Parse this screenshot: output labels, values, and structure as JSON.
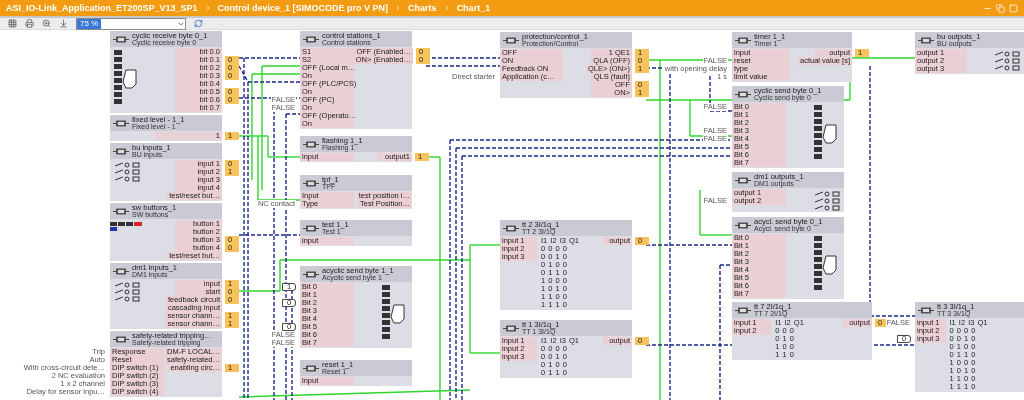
{
  "title_bar": {
    "path": [
      "ASI_IO-Link_Application_ET200SP_V13_SP1",
      "Control device_1 [SIMOCODE pro V PN]",
      "Charts",
      "Chart_1"
    ]
  },
  "toolbar": {
    "zoom": "75 %"
  },
  "blocks": [
    {
      "kind": "byte",
      "title": "cyclic receive byte 0_1",
      "subtitle": "Cyclic receive byte 0",
      "outputs": [
        {
          "name": "bit 0.0"
        },
        {
          "name": "bit 0.1",
          "value": "0"
        },
        {
          "name": "bit 0.2",
          "value": "0"
        },
        {
          "name": "bit 0.3",
          "value": "0"
        },
        {
          "name": "bit 0.4"
        },
        {
          "name": "bit 0.5",
          "value": "0"
        },
        {
          "name": "bit 0.6",
          "value": "0"
        },
        {
          "name": "bit 0.7"
        }
      ]
    },
    {
      "kind": "plain",
      "title": "control stations_1",
      "subtitle": "Control stations",
      "inputs": [
        {
          "name": "S1"
        },
        {
          "name": "S2"
        },
        {
          "name": "OFF (Local m…"
        },
        {
          "name": "On"
        },
        {
          "name": "OFF (PLC/PCS)"
        },
        {
          "name": "On"
        },
        {
          "name": "OFF (PC)",
          "note": "FALSE"
        },
        {
          "name": "On",
          "note": "FALSE"
        },
        {
          "name": "OFF (Operato…"
        },
        {
          "name": "On"
        }
      ],
      "outputs": [
        {
          "name": "OFF (Enabled…",
          "value": "0"
        },
        {
          "name": "ON> (Enabled…",
          "value": "0"
        }
      ]
    },
    {
      "kind": "plain",
      "title": "protection/control_1",
      "subtitle": "Protection/Control",
      "inputs": [
        {
          "name": "OFF"
        },
        {
          "name": "ON"
        },
        {
          "name": "Feedback ON"
        },
        {
          "name": "Application (c…",
          "note": "Direct starter"
        }
      ],
      "outputs": [
        {
          "name": "1 QE1",
          "value": "1"
        },
        {
          "name": "QLA (OFF)",
          "value": "0"
        },
        {
          "name": "QLE> (ON>)",
          "value": "1"
        },
        {
          "name": "QLS (fault)"
        },
        {
          "name": "OFF",
          "value": "0"
        },
        {
          "name": "ON>",
          "value": "1"
        }
      ]
    },
    {
      "kind": "plain",
      "title": "timer 1_1",
      "subtitle": "Timer 1",
      "inputs": [
        {
          "name": "input"
        },
        {
          "name": "reset",
          "note": "FALSE"
        },
        {
          "name": "type",
          "note": "with opening delay"
        },
        {
          "name": "limit value",
          "note": "1 s"
        }
      ],
      "outputs": [
        {
          "name": "output",
          "value": "1"
        },
        {
          "name": "actual value [s]"
        }
      ]
    },
    {
      "kind": "switches",
      "title": "bu outputs_1",
      "subtitle": "BU outputs",
      "inputs": [
        {
          "name": "output 1"
        },
        {
          "name": "output 2"
        },
        {
          "name": "output 3"
        }
      ]
    },
    {
      "kind": "plain",
      "title": "fixed level - 1_1",
      "subtitle": "Fixed level - 1",
      "outputs": [
        {
          "name": "1",
          "value": "1"
        }
      ]
    },
    {
      "kind": "plain",
      "title": "flashing 1_1",
      "subtitle": "Flashing 1",
      "inputs": [
        {
          "name": "input"
        }
      ],
      "outputs": [
        {
          "name": "output1",
          "value": "1"
        }
      ]
    },
    {
      "kind": "byte",
      "title": "cyclic send byte 0_1",
      "subtitle": "Cyclic send byte 0",
      "inputs": [
        {
          "name": "Bit 0",
          "note": "FALSE"
        },
        {
          "name": "Bit 1"
        },
        {
          "name": "Bit 2"
        },
        {
          "name": "Bit 3",
          "note": "FALSE"
        },
        {
          "name": "Bit 4",
          "note": "FALSE"
        },
        {
          "name": "Bit 5"
        },
        {
          "name": "Bit 6"
        },
        {
          "name": "Bit 7"
        }
      ]
    },
    {
      "kind": "switches",
      "title": "bu inputs_1",
      "subtitle": "BU inputs",
      "outputs": [
        {
          "name": "input 1",
          "value": "0"
        },
        {
          "name": "input 2",
          "value": "1"
        },
        {
          "name": "input 3"
        },
        {
          "name": "input 4"
        },
        {
          "name": "test/reset but…"
        }
      ]
    },
    {
      "kind": "plain",
      "title": "tpf_1",
      "subtitle": "TPF",
      "inputs": [
        {
          "name": "Input"
        },
        {
          "name": "Type",
          "note": "NC contact"
        }
      ],
      "outputs": [
        {
          "name": "test position i…"
        },
        {
          "name": "Test Position…"
        }
      ]
    },
    {
      "kind": "switches",
      "title": "dm1 outputs_1",
      "subtitle": "DM1 outputs",
      "inputs": [
        {
          "name": "output 1"
        },
        {
          "name": "output 2",
          "note": "FALSE"
        }
      ]
    },
    {
      "kind": "buttons",
      "title": "sw buttons_1",
      "subtitle": "SW buttons",
      "outputs": [
        {
          "name": "button 1"
        },
        {
          "name": "button 2"
        },
        {
          "name": "button 3",
          "value": "0"
        },
        {
          "name": "button 4",
          "value": "0"
        },
        {
          "name": "test/reset but…"
        }
      ]
    },
    {
      "kind": "plain",
      "title": "test 1_1",
      "subtitle": "Test 1",
      "inputs": [
        {
          "name": "input"
        }
      ]
    },
    {
      "kind": "byte",
      "title": "acycl. send byte 0_1",
      "subtitle": "Acycl. send byte 0",
      "inputs": [
        {
          "name": "Bit 0"
        },
        {
          "name": "Bit 1"
        },
        {
          "name": "Bit 2"
        },
        {
          "name": "Bit 3"
        },
        {
          "name": "Bit 4"
        },
        {
          "name": "Bit 5"
        },
        {
          "name": "Bit 6"
        },
        {
          "name": "Bit 7"
        }
      ]
    },
    {
      "kind": "switches",
      "title": "dm1 inputs_1",
      "subtitle": "DM1 inputs",
      "outputs": [
        {
          "name": "input",
          "value": "1"
        },
        {
          "name": "start",
          "value": "0"
        },
        {
          "name": "feedback circuit",
          "value": "0"
        },
        {
          "name": "cascading input"
        },
        {
          "name": "sensor chann…",
          "value": "1"
        },
        {
          "name": "sensor chann…",
          "value": "1"
        }
      ]
    },
    {
      "kind": "byte",
      "title": "acyclic send byte 1_1",
      "subtitle": "Acyclic send byte 1",
      "inputs": [
        {
          "name": "Bit 0",
          "const": "1"
        },
        {
          "name": "Bit 1"
        },
        {
          "name": "Bit 2",
          "const": "0"
        },
        {
          "name": "Bit 3"
        },
        {
          "name": "Bit 4"
        },
        {
          "name": "Bit 5",
          "const": "0"
        },
        {
          "name": "Bit 6",
          "note": "FALSE"
        },
        {
          "name": "Bit 7",
          "note": "FALSE"
        }
      ]
    },
    {
      "kind": "plain",
      "title": "safety-related tripping…",
      "subtitle": "Safety-related tripping",
      "inputs": [
        {
          "name": "Response",
          "note": "Trip"
        },
        {
          "name": "Reset",
          "note": "Auto"
        },
        {
          "name": "DIP switch (1)",
          "note": "With cross-circuit dete…"
        },
        {
          "name": "DIP switch (2)",
          "note": "2 NC evaluation"
        },
        {
          "name": "DIP switch (3)",
          "note": "1 x 2 channel"
        },
        {
          "name": "DIP switch (4)",
          "note": "Delay for sensor inpu…"
        }
      ],
      "outputs": [
        {
          "name": "DM-F LOCAL…"
        },
        {
          "name": "safety-related…"
        },
        {
          "name": "enabling circ…",
          "value": "1"
        }
      ]
    },
    {
      "kind": "plain",
      "title": "reset 1_1",
      "subtitle": "Reset 1",
      "inputs": [
        {
          "name": "input"
        }
      ]
    },
    {
      "kind": "plain",
      "title": "tt 2 3I/1q_1",
      "subtitle": "TT 2 3I/1Q",
      "table": [
        "I1 I2 I3 Q1",
        "0 0 0 0",
        "0 0 1 0",
        "0 1 0 0",
        "0 1 1 0",
        "1 0 0 0",
        "1 0 1 0",
        "1 1 0 0",
        "1 1 1 0"
      ],
      "inputs": [
        {
          "name": "input 1"
        },
        {
          "name": "input 2"
        },
        {
          "name": "input 3"
        }
      ],
      "outputs": [
        {
          "name": "output",
          "value": "0"
        }
      ]
    },
    {
      "kind": "plain",
      "title": "tt 1 3I/1q_1",
      "subtitle": "TT 1 3I/1Q",
      "table": [
        "I1 I2 I3 Q1",
        "0 0 0 0",
        "0 0 1 0",
        "0 1 0 0",
        "0 1 1 0"
      ],
      "inputs": [
        {
          "name": "input 1"
        },
        {
          "name": "input 2"
        },
        {
          "name": "input 3"
        }
      ],
      "outputs": [
        {
          "name": "output",
          "value": "0"
        }
      ]
    },
    {
      "kind": "plain",
      "title": "tt 7 2I/1q_1",
      "subtitle": "TT 7 2I/1Q",
      "table": [
        "I1 I2 Q1",
        "0 0 0",
        "0 1 0",
        "1 0 0",
        "1 1 0"
      ],
      "inputs": [
        {
          "name": "input 1"
        },
        {
          "name": "input 2"
        }
      ],
      "outputs": [
        {
          "name": "output",
          "value": "0"
        }
      ]
    },
    {
      "kind": "plain",
      "title": "tt 3 3I/1q_1",
      "subtitle": "TT 3 3I/1Q",
      "table": [
        "I1 I2 I3 Q1",
        "0 0 0 0",
        "0 0 1 0",
        "0 1 0 0",
        "0 1 1 0",
        "1 0 0 0",
        "1 0 1 0",
        "1 1 0 0",
        "1 1 1 0"
      ],
      "inputs": [
        {
          "name": "input 1",
          "note": "FALSE"
        },
        {
          "name": "input 2"
        },
        {
          "name": "input 3",
          "const": "0"
        }
      ]
    }
  ]
}
